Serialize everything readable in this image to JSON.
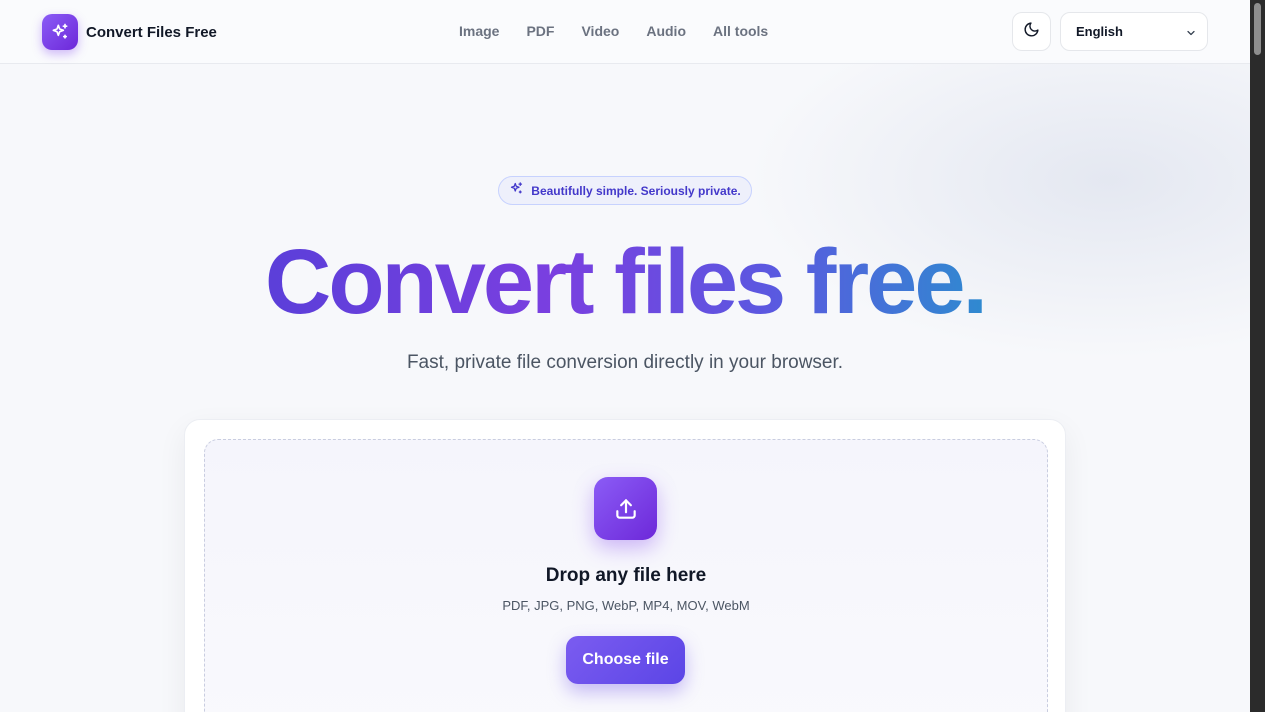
{
  "header": {
    "brand_name": "Convert Files Free",
    "nav": [
      "Image",
      "PDF",
      "Video",
      "Audio",
      "All tools"
    ],
    "language_selected": "English",
    "icons": {
      "logo": "sparkles-icon",
      "theme": "moon-icon",
      "language": "chevron-down-icon"
    }
  },
  "hero": {
    "badge": "Beautifully simple. Seriously private.",
    "title": "Convert files free.",
    "subtitle": "Fast, private file conversion directly in your browser."
  },
  "dropzone": {
    "title": "Drop any file here",
    "formats": "PDF, JPG, PNG, WebP, MP4, MOV, WebM",
    "button_label": "Choose file",
    "icon": "upload-icon"
  },
  "colors": {
    "accent": "#7c3aed",
    "accent_dark": "#6d28d9",
    "gradient_end": "#2f8ad0"
  }
}
